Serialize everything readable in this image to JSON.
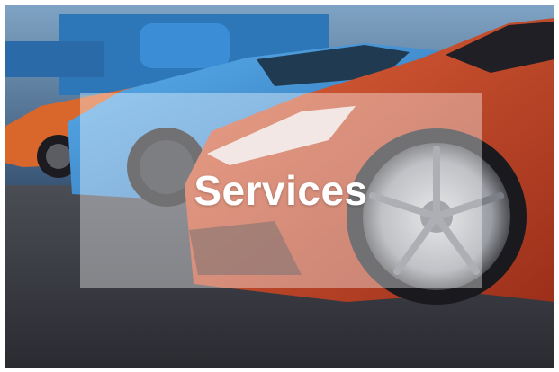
{
  "tile": {
    "title": "Services",
    "image_icon": "car-photo-icon"
  },
  "colors": {
    "overlay": "#ffffff",
    "title_text": "#ffffff",
    "car_red": "#c8472a",
    "car_blue": "#3f8fd6",
    "car_orange": "#d9662a"
  }
}
